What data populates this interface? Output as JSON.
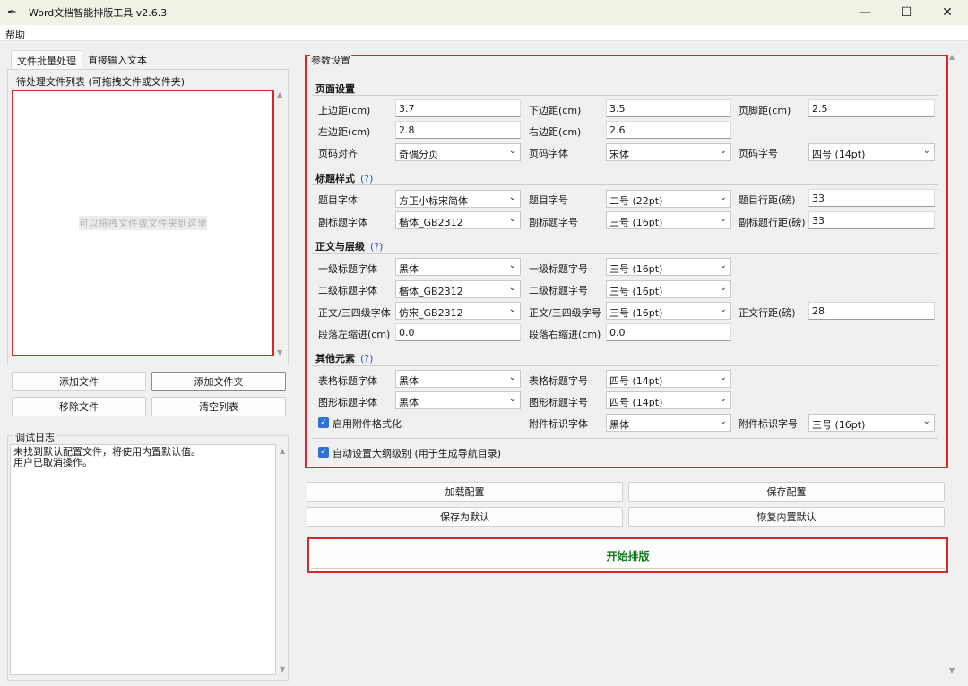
{
  "window": {
    "title": "Word文档智能排版工具 v2.6.3",
    "minimize": "—",
    "maximize": "☐",
    "close": "✕"
  },
  "menu": {
    "help": "帮助"
  },
  "tabs": [
    {
      "label": "文件批量处理"
    },
    {
      "label": "直接输入文本"
    }
  ],
  "filelist": {
    "legend": "待处理文件列表 (可拖拽文件或文件夹)",
    "hint": "可以拖拽文件或文件夹到这里"
  },
  "file_buttons": {
    "add_file": "添加文件",
    "add_folder": "添加文件夹",
    "remove_file": "移除文件",
    "clear_list": "清空列表"
  },
  "log": {
    "legend": "调试日志",
    "lines": [
      "未找到默认配置文件，将使用内置默认值。",
      "用户已取消操作。"
    ]
  },
  "params": {
    "legend": "参数设置",
    "page": {
      "title": "页面设置",
      "top_margin_label": "上边距(cm)",
      "top_margin": "3.7",
      "bottom_margin_label": "下边距(cm)",
      "bottom_margin": "3.5",
      "footer_margin_label": "页脚距(cm)",
      "footer_margin": "2.5",
      "left_margin_label": "左边距(cm)",
      "left_margin": "2.8",
      "right_margin_label": "右边距(cm)",
      "right_margin": "2.6",
      "pagenum_align_label": "页码对齐",
      "pagenum_align": "奇偶分页",
      "pagenum_font_label": "页码字体",
      "pagenum_font": "宋体",
      "pagenum_size_label": "页码字号",
      "pagenum_size": "四号 (14pt)"
    },
    "title_style": {
      "title": "标题样式",
      "help": "(?)",
      "title_font_label": "题目字体",
      "title_font": "方正小标宋简体",
      "title_size_label": "题目字号",
      "title_size": "二号 (22pt)",
      "title_spacing_label": "题目行距(磅)",
      "title_spacing": "33",
      "subtitle_font_label": "副标题字体",
      "subtitle_font": "楷体_GB2312",
      "subtitle_size_label": "副标题字号",
      "subtitle_size": "三号 (16pt)",
      "subtitle_spacing_label": "副标题行距(磅)",
      "subtitle_spacing": "33"
    },
    "body": {
      "title": "正文与层级",
      "help": "(?)",
      "h1_font_label": "一级标题字体",
      "h1_font": "黑体",
      "h1_size_label": "一级标题字号",
      "h1_size": "三号 (16pt)",
      "h2_font_label": "二级标题字体",
      "h2_font": "楷体_GB2312",
      "h2_size_label": "二级标题字号",
      "h2_size": "三号 (16pt)",
      "body_font_label": "正文/三四级字体",
      "body_font": "仿宋_GB2312",
      "body_size_label": "正文/三四级字号",
      "body_size": "三号 (16pt)",
      "body_spacing_label": "正文行距(磅)",
      "body_spacing": "28",
      "left_indent_label": "段落左缩进(cm)",
      "left_indent": "0.0",
      "right_indent_label": "段落右缩进(cm)",
      "right_indent": "0.0"
    },
    "other": {
      "title": "其他元素",
      "help": "(?)",
      "table_font_label": "表格标题字体",
      "table_font": "黑体",
      "table_size_label": "表格标题字号",
      "table_size": "四号 (14pt)",
      "figure_font_label": "图形标题字体",
      "figure_font": "黑体",
      "figure_size_label": "图形标题字号",
      "figure_size": "四号 (14pt)",
      "attach_enable_label": "启用附件格式化",
      "attach_font_label": "附件标识字体",
      "attach_font": "黑体",
      "attach_size_label": "附件标识字号",
      "attach_size": "三号 (16pt)",
      "outline_label": "自动设置大纲级别 (用于生成导航目录)"
    }
  },
  "config_buttons": {
    "load": "加载配置",
    "save": "保存配置",
    "save_default": "保存为默认",
    "restore_default": "恢复内置默认"
  },
  "start_button": "开始排版"
}
